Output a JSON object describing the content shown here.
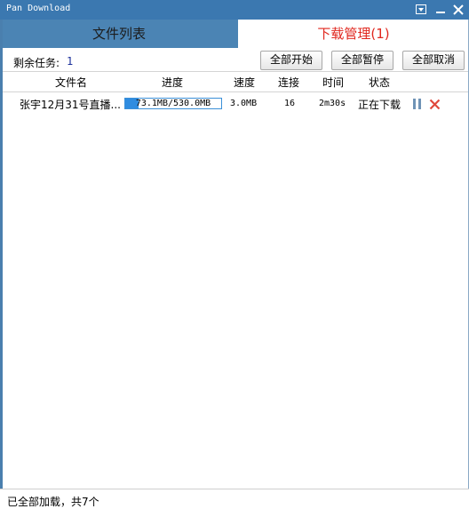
{
  "window": {
    "title": "Pan Download"
  },
  "tabs": {
    "files": "文件列表",
    "downloads": "下载管理(1)"
  },
  "toolbar": {
    "remaining_label": "剩余任务:",
    "remaining_count": "1",
    "start_all": "全部开始",
    "pause_all": "全部暂停",
    "cancel_all": "全部取消"
  },
  "columns": [
    "文件名",
    "进度",
    "速度",
    "连接",
    "时间",
    "状态"
  ],
  "rows": [
    {
      "filename": "张宇12月31号直播...",
      "progress_text": "73.1MB/530.0MB",
      "progress_fraction": 0.138,
      "speed": "3.0MB",
      "connections": "16",
      "time": "2m30s",
      "status": "正在下载"
    }
  ],
  "statusbar": {
    "text": "已全部加载，共7个"
  },
  "colors": {
    "titlebar": "#3b78b0",
    "active_tab_text": "#e0271e",
    "progress_fill": "#2f8ce0",
    "cancel_icon": "#e0483c",
    "pause_icon": "#6f93b6"
  },
  "icons": [
    "window-menu-icon",
    "minimize-icon",
    "close-icon",
    "pause-icon",
    "cancel-icon"
  ]
}
